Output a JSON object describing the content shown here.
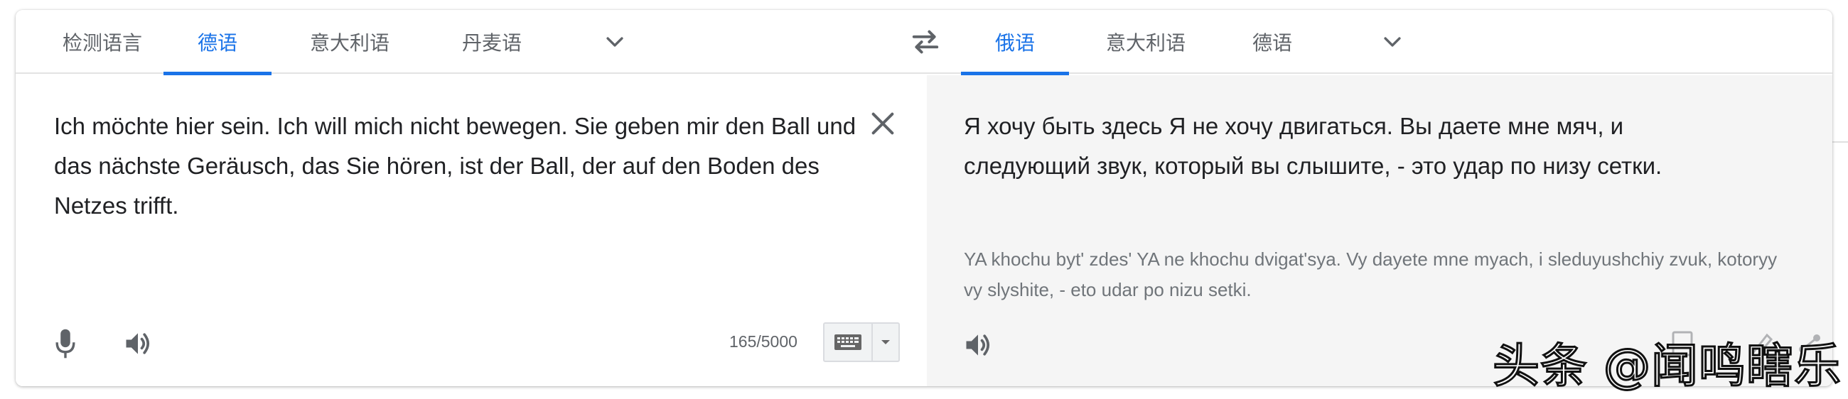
{
  "source_languages": {
    "tabs": [
      {
        "label": "检测语言",
        "active": false
      },
      {
        "label": "德语",
        "active": true
      },
      {
        "label": "意大利语",
        "active": false
      },
      {
        "label": "丹麦语",
        "active": false
      }
    ],
    "more_icon": "chevron-down-icon"
  },
  "swap_icon": "swap-horizontal-icon",
  "target_languages": {
    "tabs": [
      {
        "label": "俄语",
        "active": true
      },
      {
        "label": "意大利语",
        "active": false
      },
      {
        "label": "德语",
        "active": false
      }
    ],
    "more_icon": "chevron-down-icon"
  },
  "source": {
    "text": "Ich möchte hier sein. Ich will mich nicht bewegen. Sie geben mir den Ball und das nächste Geräusch, das Sie hören, ist der Ball, der auf den Boden des Netzes trifft.",
    "char_count": "165/5000",
    "icons": [
      "close-icon",
      "microphone-icon",
      "speaker-icon",
      "keyboard-icon",
      "dropdown-arrow-icon"
    ]
  },
  "target": {
    "text": "Я хочу быть здесь Я не хочу двигаться. Вы даете мне мяч, и следующий звук, который вы слышите, - это удар по низу сетки.",
    "transliteration": "YA khochu byt' zdes' YA ne khochu dvigat'sya. Vy dayete mne myach, i sleduyushchiy zvuk, kotoryy vy slyshite, - eto udar po nizu setki.",
    "icons": [
      "speaker-icon"
    ]
  },
  "watermark": "头条 @闻鸣瞎乐",
  "colors": {
    "accent": "#1a73e8",
    "tab_text": "#5f6368",
    "target_bg": "#f5f5f5",
    "secondary_text": "#70757a"
  }
}
